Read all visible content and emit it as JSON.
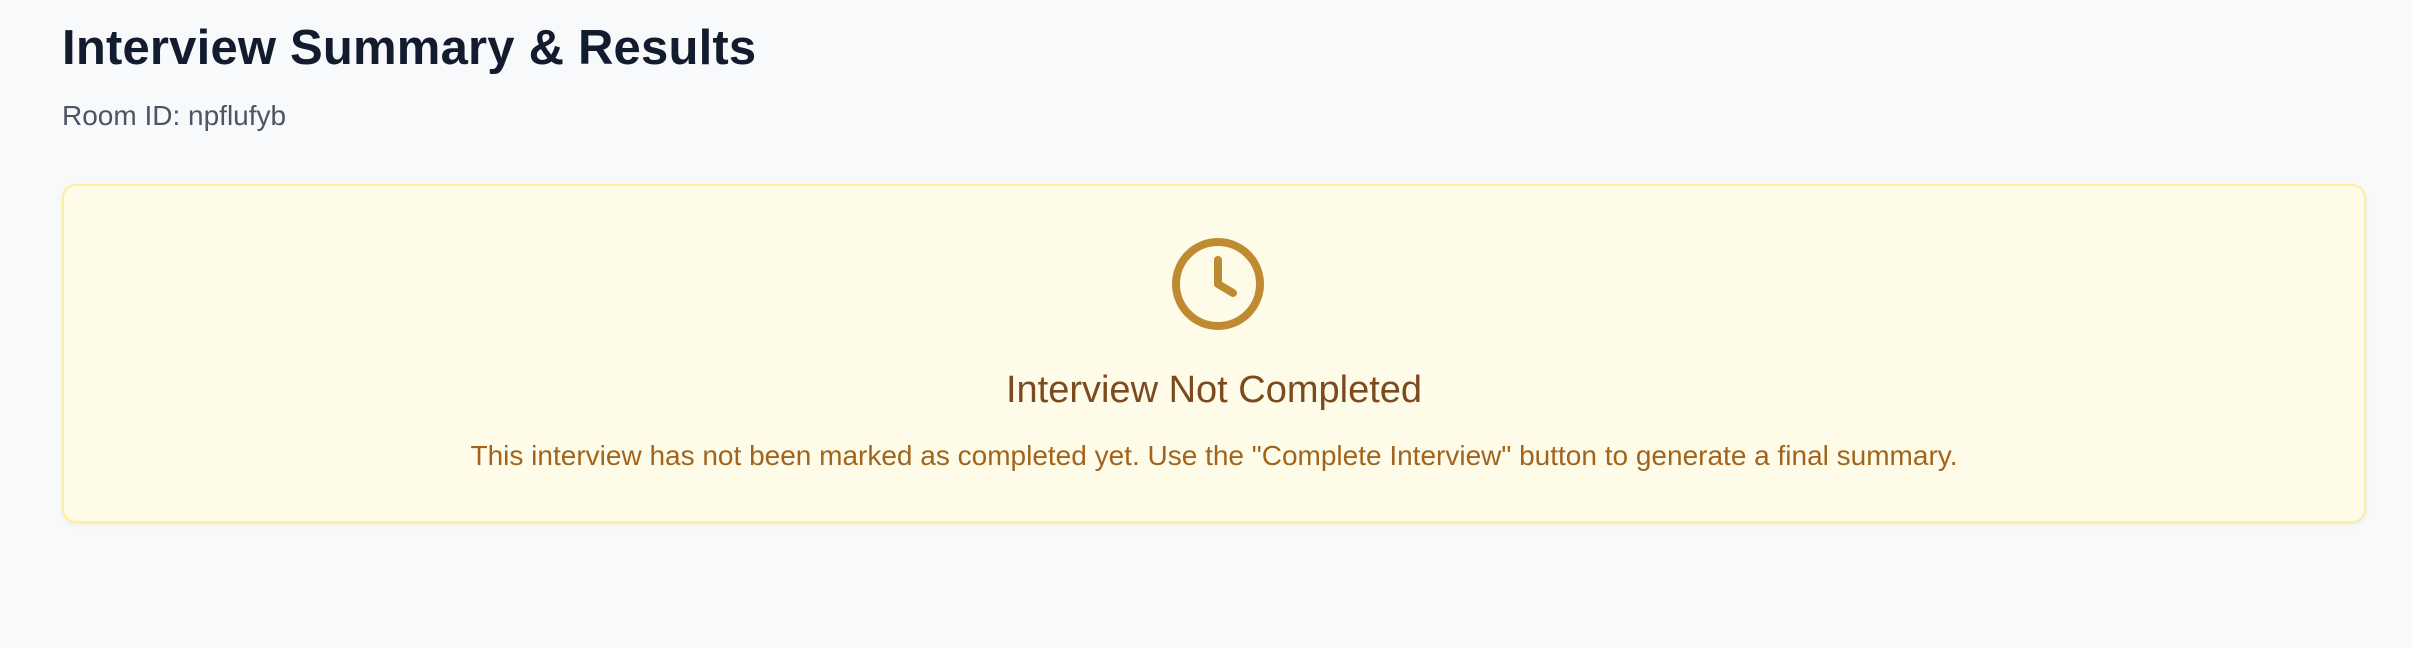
{
  "page": {
    "title": "Interview Summary & Results",
    "room_id": "Room ID: npflufyb"
  },
  "status_card": {
    "icon": "clock-icon",
    "title": "Interview Not Completed",
    "message": "This interview has not been marked as completed yet. Use the \"Complete Interview\" button to generate a final summary."
  },
  "colors": {
    "background": "#f8f9fb",
    "title_text": "#131c2e",
    "muted_text": "#4b5565",
    "card_background": "#fefce9",
    "card_border": "#fcef9f",
    "icon": "#bf8b32",
    "card_title": "#7c4a1f",
    "card_message": "#a2641c"
  }
}
